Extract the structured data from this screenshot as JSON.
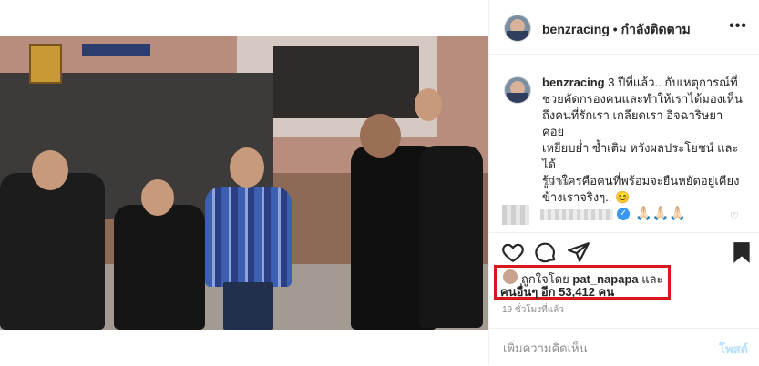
{
  "header": {
    "username": "benzracing",
    "separator": " • ",
    "follow_status": "กำลังติดตาม",
    "more_icon": "more-dots-icon"
  },
  "caption": {
    "username": "benzracing",
    "text": " 3 ปีที่แล้ว.. กับเหตุการณ์ที่\nช่วยคัดกรองคนและทำให้เราได้มองเห็น\nถึงคนที่รักเรา เกลียดเรา อิจฉาริษยา คอย\nเหยียบย่ำ ซ้ำเติม หวังผลประโยชน์ และได้\nรู้ว่าใครคือคนที่พร้อมจะยืนหยัดอยู่เคียง\nข้างเราจริงๆ.. 😊",
    "time": "19 ชม."
  },
  "comment": {
    "emoji": "🙏🏻🙏🏻🙏🏻",
    "verified_icon": "verified-badge-icon"
  },
  "actions": {
    "like_icon": "heart-icon",
    "comment_icon": "comment-bubble-icon",
    "share_icon": "paper-plane-icon",
    "save_icon": "bookmark-icon"
  },
  "likes": {
    "prefix": "ถูกใจโดย ",
    "liker": "pat_napapa",
    "conj": " และ",
    "others": "คนอื่นๆ อีก 53,412 คน"
  },
  "post_time": "19 ชั่วโมงที่แล้ว",
  "add_comment": {
    "placeholder": "เพิ่มความคิดเห็น",
    "post_label": "โพสต์"
  }
}
